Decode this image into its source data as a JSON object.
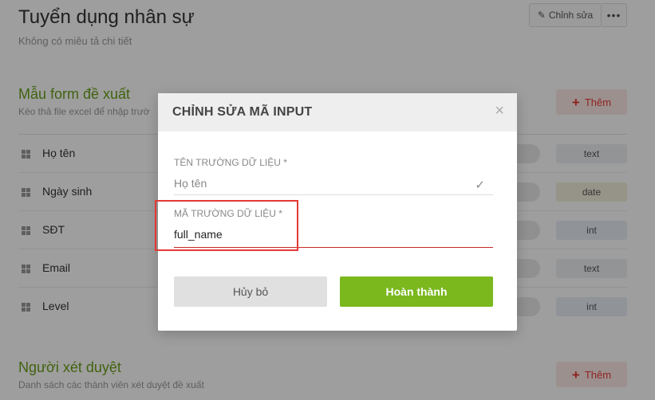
{
  "page": {
    "title": "Tuyển dụng nhân sự",
    "description": "Không có miêu tả chi tiết",
    "edit_label": "Chỉnh sửa",
    "more_label": "•••"
  },
  "form_section": {
    "title": "Mẫu form đề xuất",
    "description": "Kéo thả file excel để nhập trườ",
    "add_label": "Thêm",
    "fields": [
      {
        "label": "Họ tên",
        "type": "text"
      },
      {
        "label": "Ngày sinh",
        "type": "date"
      },
      {
        "label": "SĐT",
        "type": "int"
      },
      {
        "label": "Email",
        "type": "text"
      },
      {
        "label": "Level",
        "type": "int"
      }
    ]
  },
  "approver_section": {
    "title": "Người xét duyệt",
    "description": "Danh sách các thành viên xét duyệt đề xuất",
    "add_label": "Thêm"
  },
  "modal": {
    "title": "CHỈNH SỬA MÃ INPUT",
    "close": "×",
    "field_name_label": "TÊN TRƯỜNG DỮ LIỆU *",
    "field_name_value": "Họ tên",
    "field_code_label": "MÃ TRƯỜNG DỮ LIỆU *",
    "field_code_value": "full_name",
    "cancel_label": "Hủy bỏ",
    "done_label": "Hoàn thành"
  },
  "colors": {
    "accent_green": "#7ab81e",
    "danger_red": "#e53935"
  }
}
